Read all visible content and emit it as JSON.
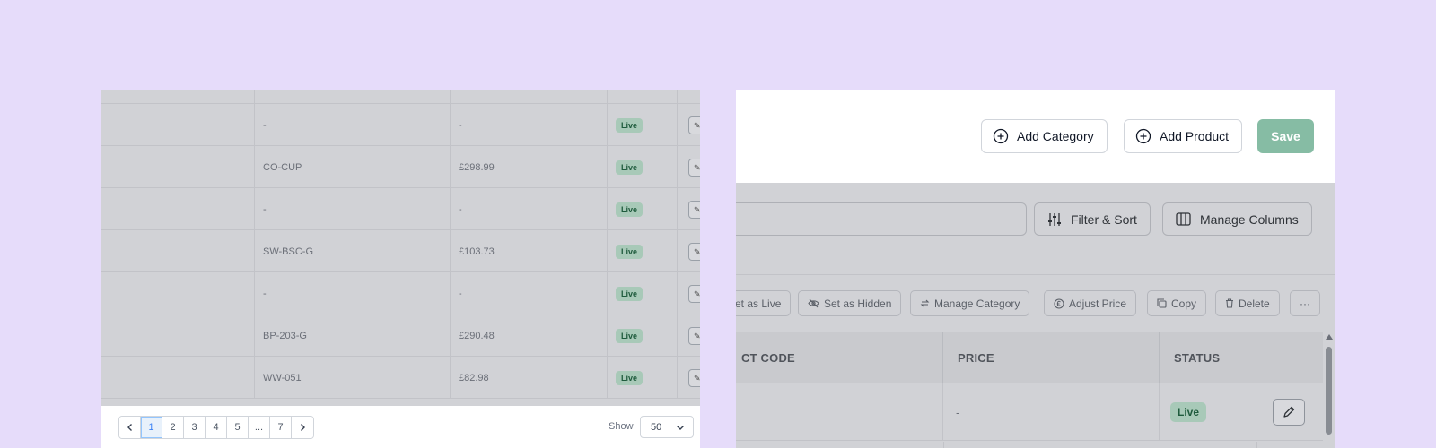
{
  "left_table": {
    "rows": [
      {
        "code": "-",
        "price": "-",
        "status": "Live"
      },
      {
        "code": "CO-CUP",
        "price": "£298.99",
        "status": "Live"
      },
      {
        "code": "-",
        "price": "-",
        "status": "Live"
      },
      {
        "code": "SW-BSC-G",
        "price": "£103.73",
        "status": "Live"
      },
      {
        "code": "-",
        "price": "-",
        "status": "Live"
      },
      {
        "code": "BP-203-G",
        "price": "£290.48",
        "status": "Live"
      },
      {
        "code": "WW-051",
        "price": "£82.98",
        "status": "Live"
      }
    ]
  },
  "pagination": {
    "pages": [
      "1",
      "2",
      "3",
      "4",
      "5",
      "...",
      "7"
    ],
    "current": "1",
    "show_label": "Show",
    "page_size": "50"
  },
  "header": {
    "add_category_label": "Add Category",
    "add_product_label": "Add Product",
    "save_label": "Save"
  },
  "toolbar": {
    "filter_sort_label": "Filter & Sort",
    "manage_columns_label": "Manage Columns"
  },
  "bulk_actions": {
    "set_live_label": "et as Live",
    "set_hidden_label": "Set as Hidden",
    "manage_category_label": "Manage Category",
    "adjust_price_label": "Adjust Price",
    "copy_label": "Copy",
    "delete_label": "Delete",
    "more_label": "···"
  },
  "right_table": {
    "columns": [
      "CT CODE",
      "PRICE",
      "STATUS"
    ],
    "row": {
      "price": "-",
      "status": "Live"
    }
  },
  "colors": {
    "accent_green": "#86bca4",
    "live_badge_bg": "#a8c9b8",
    "background": "#e6dcfa"
  }
}
